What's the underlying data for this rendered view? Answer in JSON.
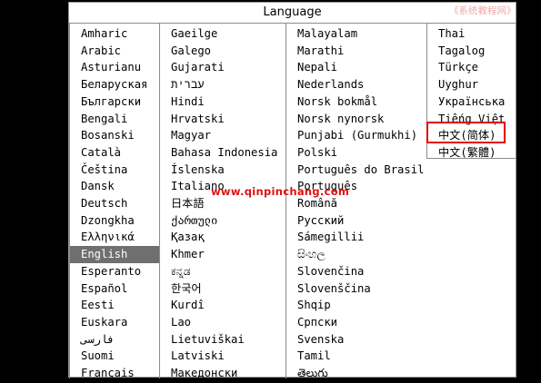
{
  "dialog": {
    "title": "Language"
  },
  "watermark": {
    "top": "《系统教程网》",
    "mid": "www.qinpinchang.com"
  },
  "columns": [
    {
      "items": [
        "Amharic",
        "Arabic",
        "Asturianu",
        "Беларуская",
        "Български",
        "Bengali",
        "Bosanski",
        "Català",
        "Čeština",
        "Dansk",
        "Deutsch",
        "Dzongkha",
        "Ελληνικά",
        "English",
        "Esperanto",
        "Español",
        "Eesti",
        "Euskara",
        "فارسی",
        "Suomi",
        "Français"
      ]
    },
    {
      "items": [
        "Gaeilge",
        "Galego",
        "Gujarati",
        "עברית",
        "Hindi",
        "Hrvatski",
        "Magyar",
        "Bahasa Indonesia",
        "Íslenska",
        "Italiano",
        "日本語",
        "ქართული",
        "Қазақ",
        "Khmer",
        "ಕನ್ನಡ",
        "한국어",
        "Kurdî",
        "Lao",
        "Lietuviškai",
        "Latviski",
        "Македонски"
      ]
    },
    {
      "items": [
        "Malayalam",
        "Marathi",
        "Nepali",
        "Nederlands",
        "Norsk bokmål",
        "Norsk nynorsk",
        "Punjabi (Gurmukhi)",
        "Polski",
        "Português do Brasil",
        "Português",
        "Română",
        "Русский",
        "Sámegillii",
        "සිංහල",
        "Slovenčina",
        "Slovenščina",
        "Shqip",
        "Српски",
        "Svenska",
        "Tamil",
        "తెలుగు"
      ]
    },
    {
      "items": [
        "Thai",
        "Tagalog",
        "Türkçe",
        "Uyghur",
        "Українська",
        "Tiếng Việt",
        "中文(简体)",
        "中文(繁體)"
      ]
    }
  ],
  "selected": "English",
  "highlighted": "中文(简体)",
  "colors": {
    "selection_bg": "#6f6f6f",
    "highlight_border": "#e00000",
    "dialog_bg": "#ffffff",
    "screen_bg": "#000000"
  }
}
